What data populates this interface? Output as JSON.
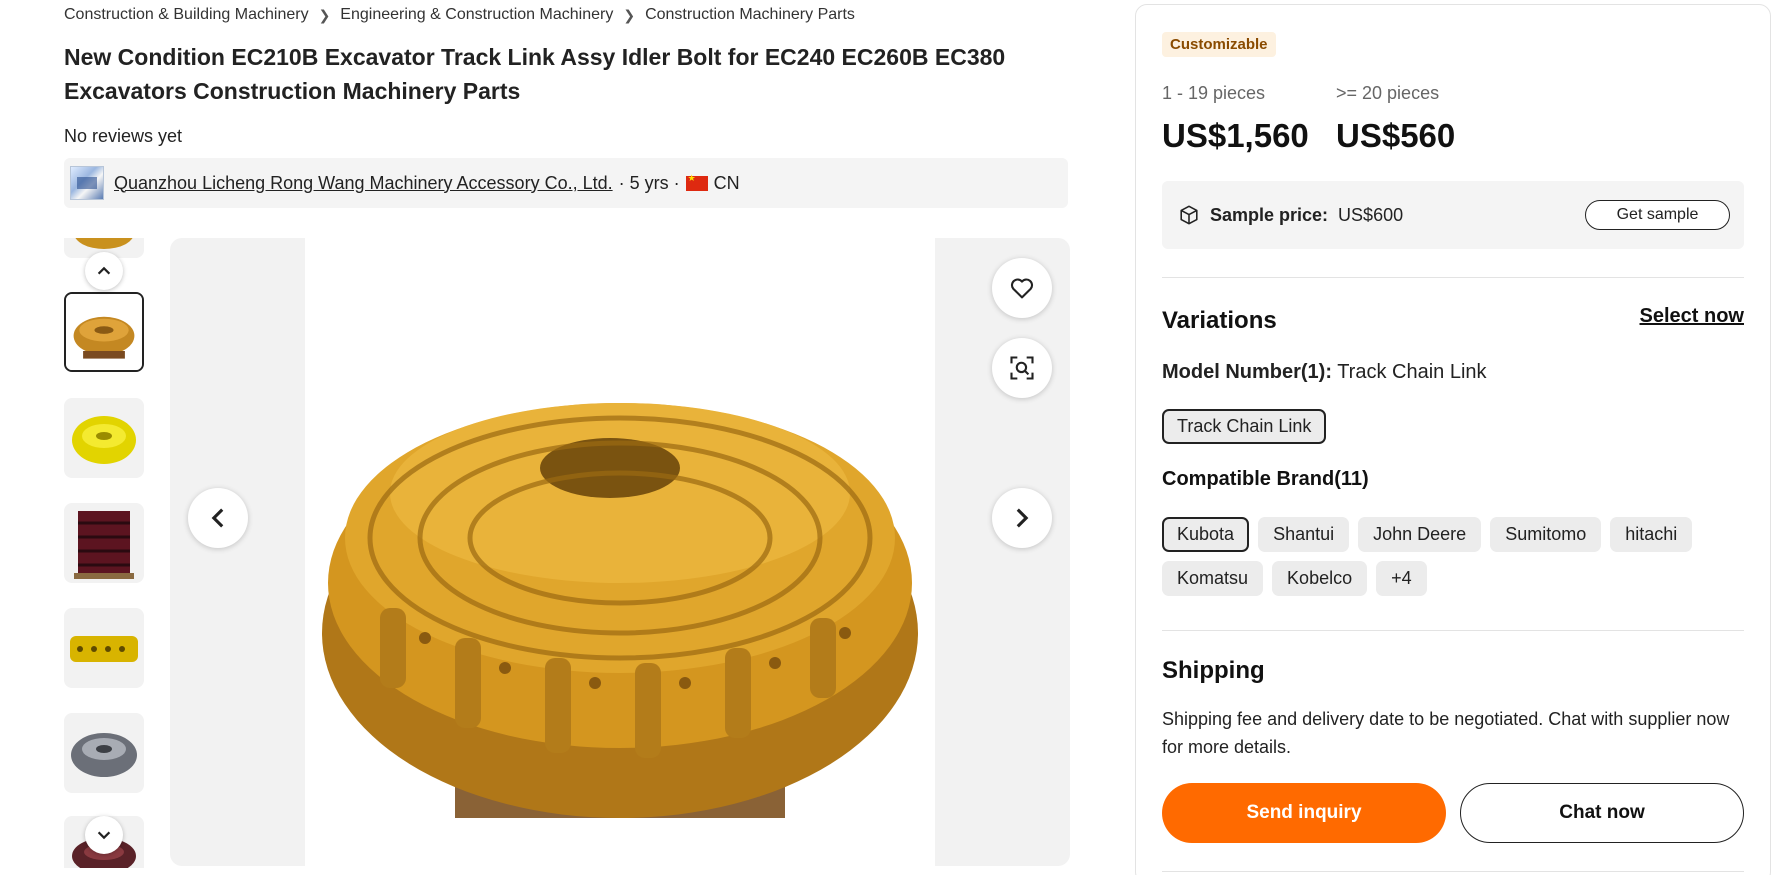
{
  "breadcrumb": [
    "Construction & Building Machinery",
    "Engineering & Construction Machinery",
    "Construction Machinery Parts"
  ],
  "product": {
    "title": "New Condition EC210B Excavator Track Link Assy Idler Bolt for EC240 EC260B EC380 Excavators Construction Machinery Parts",
    "reviews": "No reviews yet"
  },
  "supplier": {
    "name": "Quanzhou Licheng Rong Wang Machinery Accessory Co., Ltd.",
    "years": "· 5 yrs ·",
    "country": "CN"
  },
  "gallery": {
    "thumbnails": [
      "yellow-track-chain",
      "yellow-track-link",
      "dark-red-track-chain",
      "yellow-track-link-flat",
      "grey-track-chain",
      "dark-track-chain"
    ],
    "active_index": 0
  },
  "pricing": {
    "badge": "Customizable",
    "tiers": [
      {
        "qty": "1 - 19 pieces",
        "price": "US$1,560"
      },
      {
        "qty": ">= 20 pieces",
        "price": "US$560"
      }
    ],
    "sample_label": "Sample price:",
    "sample_price": "US$600",
    "sample_button": "Get sample"
  },
  "variations": {
    "title": "Variations",
    "select_now": "Select now",
    "model_label": "Model Number(1):",
    "model_value": "Track Chain Link",
    "model_options": [
      "Track Chain Link"
    ],
    "brand_label": "Compatible Brand(11)",
    "brand_options": [
      "Kubota",
      "Shantui",
      "John Deere",
      "Sumitomo",
      "hitachi",
      "Komatsu",
      "Kobelco",
      "+4"
    ]
  },
  "shipping": {
    "title": "Shipping",
    "text": "Shipping fee and delivery date to be negotiated. Chat with supplier now for more details."
  },
  "actions": {
    "inquiry": "Send inquiry",
    "chat": "Chat now"
  },
  "colors": {
    "accent": "#ff6a00",
    "badge_bg": "#fdf1e0",
    "badge_text": "#8a4b00",
    "track_yellow": "#d9a12a"
  }
}
